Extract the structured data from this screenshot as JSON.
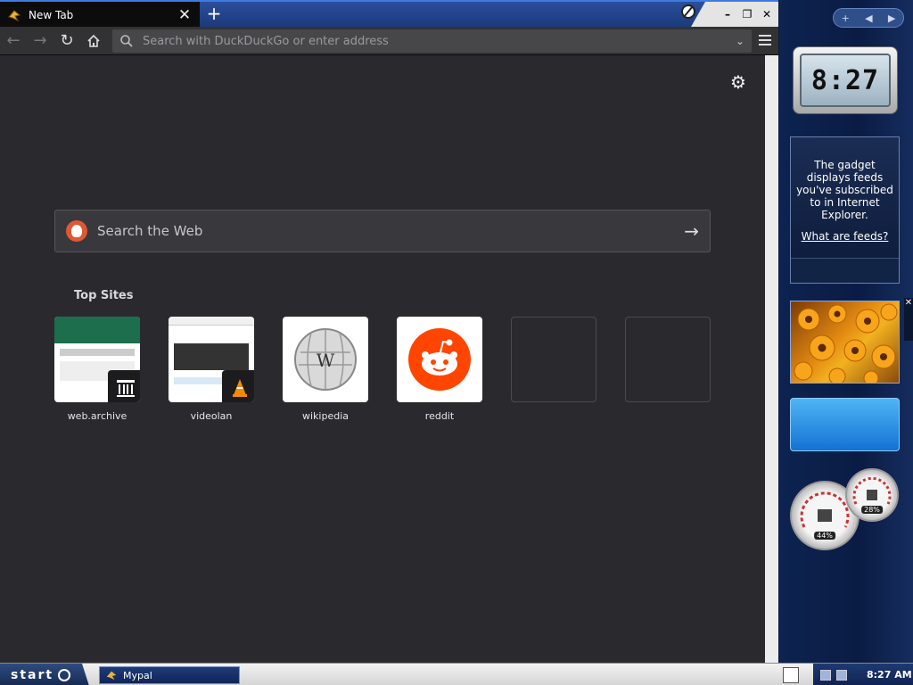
{
  "browser": {
    "tab_title": "New Tab",
    "new_tab_label": "+",
    "url_placeholder": "Search with DuckDuckGo or enter address"
  },
  "newtab": {
    "search_label": "Search the Web",
    "top_sites_title": "Top Sites",
    "sites": [
      {
        "name": "web.archive"
      },
      {
        "name": "videolan"
      },
      {
        "name": "wikipedia"
      },
      {
        "name": "reddit"
      },
      {
        "name": ""
      },
      {
        "name": ""
      }
    ]
  },
  "gadgets": {
    "clock_time": "8:27",
    "feeds_text": "The gadget displays feeds you've subscribed to in Internet Explorer.",
    "feeds_link": "What are feeds?",
    "cpu_percent": "44%",
    "mem_percent": "28%"
  },
  "taskbar": {
    "start_label": "start",
    "task_label": "Mypal",
    "time": "8:27 AM"
  },
  "colors": {
    "accent": "#de5833",
    "reddit": "#ff4500",
    "window_bg": "#2a2a2e"
  }
}
